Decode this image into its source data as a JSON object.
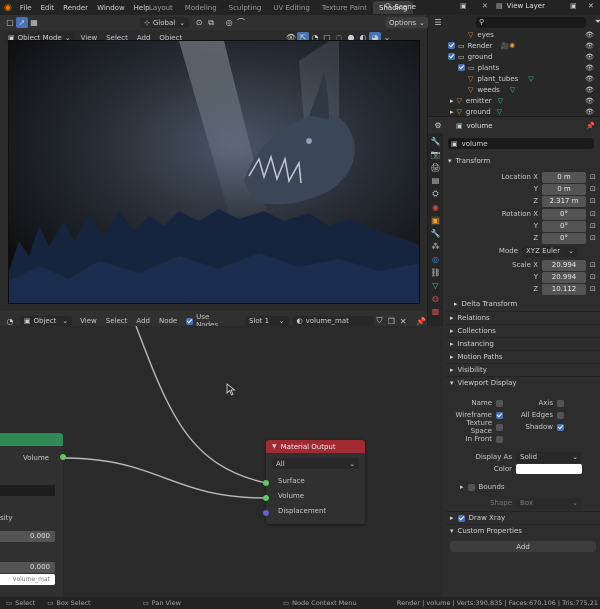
{
  "topbar": {
    "menus": [
      "File",
      "Edit",
      "Render",
      "Window",
      "Help"
    ],
    "workspaces": [
      "Layout",
      "Modeling",
      "Sculpting",
      "UV Editing",
      "Texture Paint",
      "Shading"
    ],
    "active_workspace": "Shading",
    "scene": "Scene",
    "view_layer": "View Layer"
  },
  "viewport": {
    "mode": "Object Mode",
    "menus": [
      "View",
      "Select",
      "Add",
      "Object"
    ],
    "transform_orientation": "Global",
    "options_label": "Options"
  },
  "outliner": {
    "search_placeholder": "",
    "items": [
      {
        "label": "eyes",
        "indent": 2
      },
      {
        "label": "Render",
        "indent": 1
      },
      {
        "label": "ground",
        "indent": 1
      },
      {
        "label": "plants",
        "indent": 2
      },
      {
        "label": "plant_tubes",
        "indent": 3
      },
      {
        "label": "weeds",
        "indent": 3
      },
      {
        "label": "emitter",
        "indent": 2
      },
      {
        "label": "ground",
        "indent": 2
      }
    ]
  },
  "properties": {
    "header_name": "volume",
    "object_name": "volume",
    "transform_title": "Transform",
    "location_label": "Location X",
    "location": [
      "0 m",
      "0 m",
      "2.317 m"
    ],
    "rotation_label": "Rotation X",
    "rotation": [
      "0°",
      "0°",
      "0°"
    ],
    "mode_label": "Mode",
    "mode_value": "XYZ Euler",
    "scale_label": "Scale X",
    "scale": [
      "20.994",
      "20.994",
      "10.112"
    ],
    "axis_y": "Y",
    "axis_z": "Z",
    "delta_transform": "Delta Transform",
    "collapsed_sections": [
      "Relations",
      "Collections",
      "Instancing",
      "Motion Paths",
      "Visibility"
    ],
    "viewport_display_title": "Viewport Display",
    "vd_name": "Name",
    "vd_axis": "Axis",
    "vd_wireframe": "Wireframe",
    "vd_all_edges": "All Edges",
    "vd_texture_space": "Texture Space",
    "vd_shadow": "Shadow",
    "vd_in_front": "In Front",
    "display_as_label": "Display As",
    "display_as_value": "Solid",
    "color_label": "Color",
    "bounds_label": "Bounds",
    "shape_label": "Shape",
    "shape_value": "Box",
    "draw_xray": "Draw Xray",
    "custom_props": "Custom Properties",
    "add_label": "Add"
  },
  "node_editor": {
    "mode": "Object",
    "menus": [
      "View",
      "Select",
      "Add",
      "Node"
    ],
    "use_nodes": "Use Nodes",
    "slot": "Slot 1",
    "material": "volume_mat",
    "output_node": {
      "title": "Material Output",
      "target": "All",
      "sockets": [
        "Surface",
        "Volume",
        "Displacement"
      ]
    },
    "left_node": {
      "output_socket": "Volume",
      "partial_label": "sity",
      "value1": "0.000",
      "value2": "0.000",
      "bottom_text": "volume_mat"
    }
  },
  "statusbar": {
    "select": "Select",
    "box_select": "Box Select",
    "pan_view": "Pan View",
    "context_menu": "Node Context Menu",
    "stats": "Render | volume | Verts:390,835 | Faces:670,106 | Tris:775,21"
  },
  "colors": {
    "accent_blue": "#4772b3",
    "material_output_header": "#a02a32",
    "shader_node_header": "#2e8b57",
    "socket_green": "#63c763",
    "socket_blue": "#6363c7"
  }
}
